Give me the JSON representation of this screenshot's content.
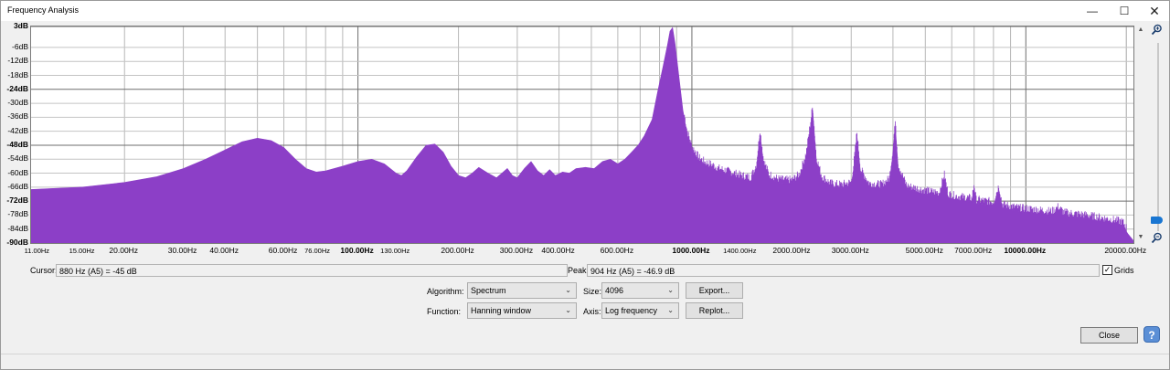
{
  "window": {
    "title": "Frequency Analysis",
    "controls": {
      "minimize": "—",
      "maximize": "☐",
      "close": "✕"
    }
  },
  "chart_data": {
    "type": "area",
    "x_scale": "log",
    "xlim": [
      10.5,
      21000
    ],
    "ylim": [
      -90,
      3
    ],
    "grid": true,
    "color": "#8c3fc7",
    "y_ticks": [
      {
        "label": "3dB",
        "value": 3,
        "bold": true
      },
      {
        "label": "-6dB",
        "value": -6
      },
      {
        "label": "-12dB",
        "value": -12
      },
      {
        "label": "-18dB",
        "value": -18
      },
      {
        "label": "-24dB",
        "value": -24,
        "bold": true
      },
      {
        "label": "-30dB",
        "value": -30
      },
      {
        "label": "-36dB",
        "value": -36
      },
      {
        "label": "-42dB",
        "value": -42
      },
      {
        "label": "-48dB",
        "value": -48,
        "bold": true
      },
      {
        "label": "-54dB",
        "value": -54
      },
      {
        "label": "-60dB",
        "value": -60
      },
      {
        "label": "-66dB",
        "value": -66
      },
      {
        "label": "-72dB",
        "value": -72,
        "bold": true
      },
      {
        "label": "-78dB",
        "value": -78
      },
      {
        "label": "-84dB",
        "value": -84
      },
      {
        "label": "-90dB",
        "value": -90,
        "bold": true
      }
    ],
    "x_ticks": [
      {
        "label": "11.00Hz",
        "value": 11,
        "small": true
      },
      {
        "label": "15.00Hz",
        "value": 15,
        "small": true
      },
      {
        "label": "20.00Hz",
        "value": 20
      },
      {
        "label": "30.00Hz",
        "value": 30
      },
      {
        "label": "40.00Hz",
        "value": 40
      },
      {
        "label": "60.00Hz",
        "value": 60
      },
      {
        "label": "76.00Hz",
        "value": 76,
        "small": true
      },
      {
        "label": "100.00Hz",
        "value": 100,
        "bold": true
      },
      {
        "label": "130.00Hz",
        "value": 130,
        "small": true
      },
      {
        "label": "200.00Hz",
        "value": 200
      },
      {
        "label": "300.00Hz",
        "value": 300
      },
      {
        "label": "400.00Hz",
        "value": 400
      },
      {
        "label": "600.00Hz",
        "value": 600
      },
      {
        "label": "1000.00Hz",
        "value": 1000,
        "bold": true
      },
      {
        "label": "1400.00Hz",
        "value": 1400,
        "small": true
      },
      {
        "label": "2000.00Hz",
        "value": 2000
      },
      {
        "label": "3000.00Hz",
        "value": 3000
      },
      {
        "label": "5000.00Hz",
        "value": 5000
      },
      {
        "label": "7000.00Hz",
        "value": 7000
      },
      {
        "label": "10000.00Hz",
        "value": 10000,
        "bold": true
      },
      {
        "label": "20000.00Hz",
        "value": 20000
      }
    ],
    "series": [
      {
        "points": [
          [
            10.5,
            -67
          ],
          [
            15,
            -66
          ],
          [
            20,
            -64
          ],
          [
            25,
            -61.5
          ],
          [
            30,
            -58
          ],
          [
            35,
            -54
          ],
          [
            40,
            -50
          ],
          [
            45,
            -46.5
          ],
          [
            50,
            -45
          ],
          [
            55,
            -46
          ],
          [
            60,
            -49
          ],
          [
            65,
            -54
          ],
          [
            70,
            -58
          ],
          [
            75,
            -59.5
          ],
          [
            80,
            -59
          ],
          [
            90,
            -57
          ],
          [
            100,
            -55
          ],
          [
            110,
            -54
          ],
          [
            120,
            -56
          ],
          [
            130,
            -60
          ],
          [
            135,
            -61
          ],
          [
            140,
            -59
          ],
          [
            150,
            -53
          ],
          [
            160,
            -48
          ],
          [
            170,
            -47.5
          ],
          [
            180,
            -51
          ],
          [
            190,
            -57
          ],
          [
            200,
            -61
          ],
          [
            210,
            -62
          ],
          [
            220,
            -60
          ],
          [
            230,
            -57.5
          ],
          [
            245,
            -60
          ],
          [
            260,
            -62
          ],
          [
            270,
            -60
          ],
          [
            280,
            -58
          ],
          [
            290,
            -61
          ],
          [
            300,
            -62
          ],
          [
            315,
            -58
          ],
          [
            330,
            -55
          ],
          [
            345,
            -59
          ],
          [
            360,
            -61
          ],
          [
            375,
            -58.5
          ],
          [
            390,
            -61
          ],
          [
            410,
            -59.5
          ],
          [
            430,
            -60
          ],
          [
            450,
            -58
          ],
          [
            480,
            -57.5
          ],
          [
            510,
            -58
          ],
          [
            540,
            -55
          ],
          [
            570,
            -54
          ],
          [
            600,
            -56
          ],
          [
            630,
            -54
          ],
          [
            660,
            -51
          ],
          [
            690,
            -48
          ],
          [
            720,
            -44
          ],
          [
            760,
            -37
          ],
          [
            790,
            -25
          ],
          [
            820,
            -14
          ],
          [
            845,
            -5
          ],
          [
            860,
            1
          ],
          [
            875,
            2.5
          ],
          [
            890,
            -4
          ],
          [
            910,
            -16
          ],
          [
            940,
            -33
          ],
          [
            970,
            -44
          ],
          [
            1000,
            -50
          ],
          [
            1050,
            -55
          ],
          [
            1100,
            -57
          ],
          [
            1150,
            -58
          ],
          [
            1200,
            -59.5
          ],
          [
            1300,
            -61
          ],
          [
            1400,
            -62.5
          ],
          [
            1500,
            -63.5
          ],
          [
            1560,
            -58
          ],
          [
            1600,
            -43
          ],
          [
            1640,
            -56
          ],
          [
            1700,
            -62
          ],
          [
            1800,
            -64
          ],
          [
            1900,
            -64.5
          ],
          [
            2000,
            -64.5
          ],
          [
            2100,
            -62
          ],
          [
            2200,
            -53
          ],
          [
            2300,
            -33
          ],
          [
            2360,
            -55
          ],
          [
            2450,
            -63
          ],
          [
            2600,
            -66
          ],
          [
            2800,
            -66.5
          ],
          [
            3000,
            -65.5
          ],
          [
            3050,
            -58
          ],
          [
            3120,
            -44
          ],
          [
            3200,
            -60
          ],
          [
            3400,
            -66
          ],
          [
            3700,
            -66.5
          ],
          [
            3900,
            -64
          ],
          [
            3990,
            -53
          ],
          [
            4060,
            -39
          ],
          [
            4150,
            -58
          ],
          [
            4400,
            -67
          ],
          [
            4800,
            -68.5
          ],
          [
            5200,
            -69.5
          ],
          [
            5500,
            -70
          ],
          [
            5700,
            -62
          ],
          [
            5850,
            -70.5
          ],
          [
            6200,
            -71.5
          ],
          [
            6900,
            -72.5
          ],
          [
            7000,
            -66
          ],
          [
            7100,
            -73
          ],
          [
            8000,
            -74
          ],
          [
            8300,
            -67
          ],
          [
            8500,
            -75
          ],
          [
            9500,
            -76.5
          ],
          [
            12000,
            -78
          ],
          [
            12500,
            -76
          ],
          [
            13000,
            -78.5
          ],
          [
            15000,
            -79.5
          ],
          [
            18000,
            -81.5
          ],
          [
            19500,
            -82.5
          ],
          [
            20200,
            -86
          ],
          [
            21000,
            -89
          ]
        ]
      }
    ]
  },
  "cursor": {
    "label": "Cursor:",
    "value": "880 Hz (A5) = -45 dB"
  },
  "peak": {
    "label": "Peak:",
    "value": "904 Hz (A5) = -46.9 dB"
  },
  "grids": {
    "label": "Grids",
    "checked": true,
    "mark": "✓"
  },
  "algorithm": {
    "label": "Algorithm:",
    "value": "Spectrum"
  },
  "function": {
    "label": "Function:",
    "value": "Hanning window"
  },
  "size": {
    "label": "Size:",
    "value": "4096"
  },
  "axis": {
    "label": "Axis:",
    "value": "Log frequency"
  },
  "buttons": {
    "export": "Export...",
    "replot": "Replot...",
    "close": "Close"
  },
  "help": "?",
  "icons": {
    "zoom_in": "zoom-in-icon",
    "zoom_out": "zoom-out-icon",
    "scroll_up": "▲",
    "scroll_down": "▼"
  }
}
